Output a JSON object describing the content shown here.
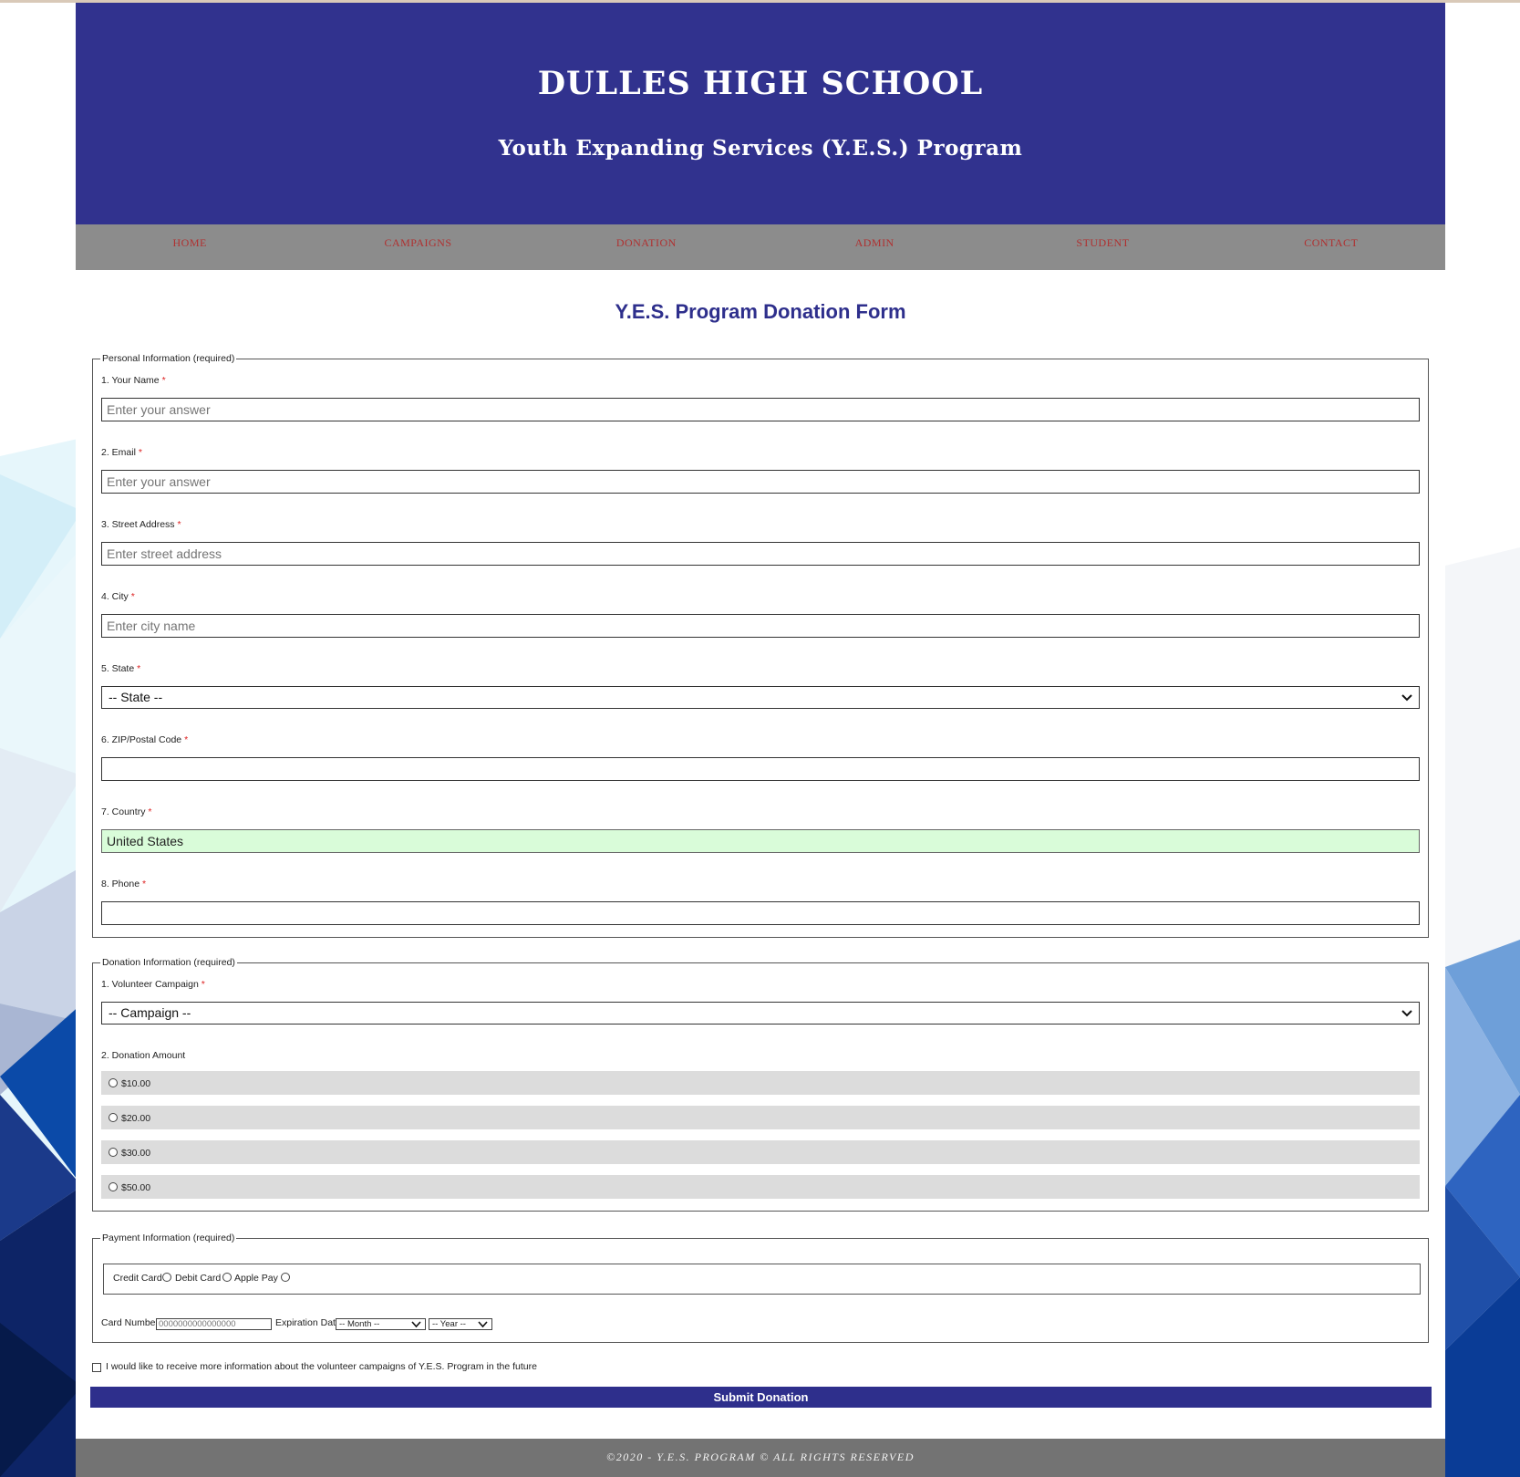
{
  "header": {
    "school_name": "DULLES HIGH SCHOOL",
    "program_name": "Youth Expanding Services (Y.E.S.) Program"
  },
  "nav": {
    "items": [
      "HOME",
      "CAMPAIGNS",
      "DONATION",
      "ADMIN",
      "STUDENT",
      "CONTACT"
    ]
  },
  "form": {
    "title": "Y.E.S. Program Donation Form",
    "personal": {
      "legend": "Personal Information (required)",
      "required_mark": "*",
      "fields": [
        {
          "label": "1. Your Name",
          "placeholder": "Enter your answer",
          "value": ""
        },
        {
          "label": "2. Email",
          "placeholder": "Enter your answer",
          "value": ""
        },
        {
          "label": "3. Street Address",
          "placeholder": "Enter street address",
          "value": ""
        },
        {
          "label": "4. City",
          "placeholder": "Enter city name",
          "value": ""
        },
        {
          "label": "5. State",
          "selected": "-- State --"
        },
        {
          "label": "6. ZIP/Postal Code",
          "placeholder": "",
          "value": ""
        },
        {
          "label": "7. Country",
          "placeholder": "",
          "value": "United States"
        },
        {
          "label": "8. Phone",
          "placeholder": "",
          "value": ""
        }
      ]
    },
    "donation": {
      "legend": "Donation Information (required)",
      "campaign_label": "1. Volunteer Campaign",
      "campaign_selected": "-- Campaign --",
      "amount_label": "2. Donation Amount",
      "amounts": [
        "$10.00",
        "$20.00",
        "$30.00",
        "$50.00"
      ]
    },
    "payment": {
      "legend": "Payment Information (required)",
      "methods": [
        "Credit Card",
        "Debit Card",
        "Apple Pay"
      ],
      "card_number_label": "Card Number",
      "card_number_placeholder": "0000000000000000",
      "expiration_label": "Expiration Date",
      "month_selected": "-- Month --",
      "year_selected": "-- Year --"
    },
    "newsletter_label": "I would like to receive more information about the volunteer campaigns of Y.E.S. Program in the future",
    "submit_label": "Submit Donation"
  },
  "footer": {
    "text": "©2020 - Y.E.S. PROGRAM © ALL RIGHTS RESERVED"
  },
  "colors": {
    "header_bg": "#31328e",
    "nav_bg": "#8c8c8c",
    "nav_link": "#b03030",
    "accent": "#2e2f8c",
    "country_fill": "#d9fcd9",
    "footer_bg": "#737373"
  }
}
